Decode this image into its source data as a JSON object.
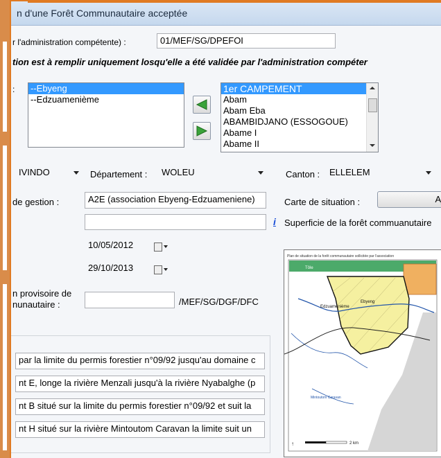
{
  "window": {
    "title": "n d'une Forêt Communautaire acceptée"
  },
  "reference": {
    "label": "r l'administration compétente) :",
    "value": "01/MEF/SG/DPEFOI"
  },
  "note": "tion est à remplir uniquement losqu'elle a été validée par l'administration compéter",
  "villages": {
    "label": ":",
    "selected": [
      "--Ebyeng",
      "--Edzuamenième"
    ],
    "available": [
      "1er CAMPEMENT",
      "Abam",
      "Abam Eba",
      "ABAMBIDJANO (ESSOGOUE)",
      "Abame I",
      "Abame II"
    ]
  },
  "province": {
    "value": "IVINDO"
  },
  "departement": {
    "label": "Département :",
    "value": "WOLEU"
  },
  "canton": {
    "label": "Canton :",
    "value": "ELLELEM"
  },
  "gestion": {
    "label": "de gestion :",
    "value": "A2E (association Ebyeng-Edzuameniene)"
  },
  "carte": {
    "label": "Carte de situation :",
    "button": "Aj"
  },
  "extra_field": {
    "value": "",
    "info_icon": "i"
  },
  "superficie": {
    "label": "Superficie de la forêt commuanutaire"
  },
  "dates": {
    "d1": "10/05/2012",
    "d2": "29/10/2013"
  },
  "provisoire": {
    "label1": "n provisoire de",
    "label2": "nunautaire :",
    "value": "",
    "suffix": "/MEF/SG/DGF/DFC"
  },
  "limits": [
    "par la limite du permis forestier n°09/92 jusqu'au domaine c",
    "nt E, longe la rivière Menzali jusqu'à la rivière Nyabalghe (p",
    "nt B situé sur la limite du permis forestier n°09/92 et suit la",
    "nt H situé sur la rivière Mintoutom Caravan la limite suit un"
  ],
  "map": {
    "title": "Plan de situation de la forêt communautaire sollicitée par l'association",
    "labels": [
      "Tôle",
      "Edzuamenième",
      "Ebyeng",
      "Mintoutom Caravan",
      "2 km"
    ],
    "colors": {
      "forest": "#f5f0a0",
      "sea": "#d6d6d6",
      "orange": "#f0b060",
      "green": "#4caa6a"
    }
  }
}
